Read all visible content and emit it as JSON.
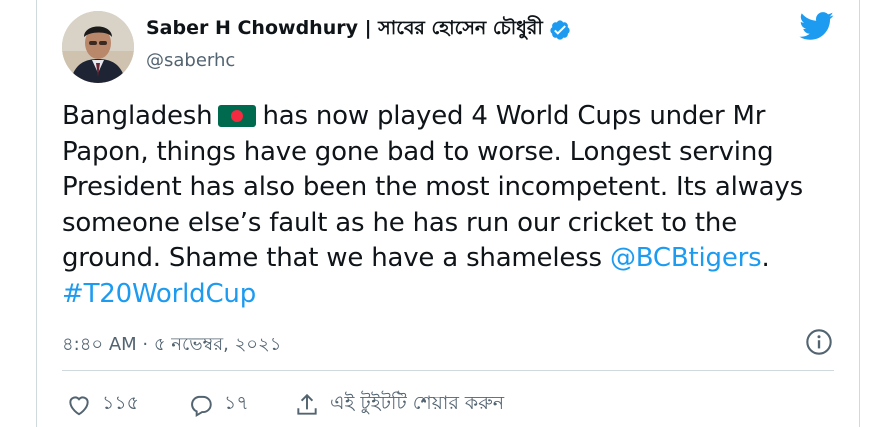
{
  "tweet": {
    "author_name": "Saber H Chowdhury | সাবের হোসেন চৌধুরী",
    "handle": "@saberhc",
    "text_parts": {
      "p1": "Bangladesh",
      "p2": "has now played 4 World Cups under Mr",
      "p3": "Papon, things have gone bad to worse. Longest serving",
      "p4": "President has also been the most incompetent. Its always",
      "p5": "someone else’s fault as he has run our cricket to the",
      "p6": "ground. Shame that we have a shameless",
      "mention": "@BCBtigers",
      "p7": ".",
      "hashtag": "#T20WorldCup"
    },
    "timestamp": "৪:৪০ AM · ৫ নভেম্বর, ২০২১",
    "likes": "১১৫",
    "replies": "১৭",
    "share_label": "এই টুইটটি শেয়ার করুন"
  },
  "icons": {
    "avatar": "avatar-photo",
    "verified": "verified-badge-icon",
    "logo": "twitter-bird-icon",
    "info": "info-icon",
    "like": "heart-icon",
    "reply": "reply-icon",
    "share": "share-icon",
    "flag": "bangladesh-flag-emoji"
  },
  "colors": {
    "link": "#1d9bf0",
    "text": "#0f1419",
    "secondary": "#536471",
    "border": "#cfd9de"
  }
}
